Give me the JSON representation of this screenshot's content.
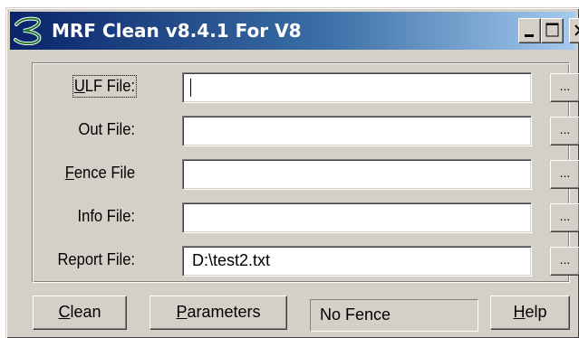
{
  "window": {
    "title": "MRF Clean v8.4.1 For V8",
    "app_icon": "mrf-logo-icon",
    "controls": [
      "minimize-icon",
      "maximize-icon",
      "close-icon"
    ]
  },
  "form": {
    "rows": [
      {
        "label_mn": "U",
        "label_rest": "LF File:",
        "value": "",
        "browse": "..."
      },
      {
        "label_mn": "",
        "label_rest": "Out File:",
        "value": "",
        "browse": "..."
      },
      {
        "label_mn": "F",
        "label_rest": "ence File",
        "value": "",
        "browse": "..."
      },
      {
        "label_mn": "",
        "label_rest": "Info File:",
        "value": "",
        "browse": "..."
      },
      {
        "label_mn": "",
        "label_rest": "Report File:",
        "value": "D:\\test2.txt",
        "browse": "..."
      }
    ]
  },
  "buttons": {
    "clean": {
      "mn": "C",
      "rest": "lean"
    },
    "parameters": {
      "mn": "P",
      "rest": "arameters"
    },
    "help": {
      "mn": "H",
      "rest": "elp"
    }
  },
  "status": {
    "fence": "No Fence"
  },
  "colors": {
    "face": "#d4d0c8",
    "title_start": "#0a246a",
    "title_end": "#a6caf0"
  }
}
